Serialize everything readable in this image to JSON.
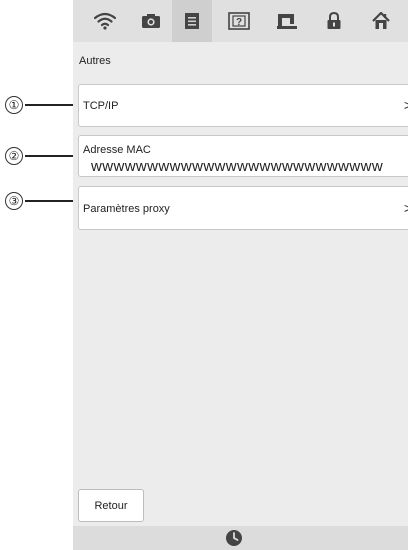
{
  "toolbar": {
    "tabs": [
      {
        "icon": "wifi-icon"
      },
      {
        "icon": "camera-icon"
      },
      {
        "icon": "document-icon",
        "active": true
      },
      {
        "icon": "help-icon"
      },
      {
        "icon": "sewing-machine-icon"
      },
      {
        "icon": "lock-icon"
      },
      {
        "icon": "home-icon"
      }
    ]
  },
  "screen": {
    "title": "Autres",
    "rows": [
      {
        "label": "TCP/IP",
        "chevron": ">"
      },
      {
        "label": "Adresse MAC",
        "value": "wwwwwwwwwwwwwwwwwwwwwwwwww"
      },
      {
        "label": "Paramètres proxy",
        "chevron": ">"
      }
    ],
    "back_label": "Retour"
  },
  "callouts": [
    "①",
    "②",
    "③"
  ],
  "bottombar": {
    "icon": "clock-icon"
  }
}
